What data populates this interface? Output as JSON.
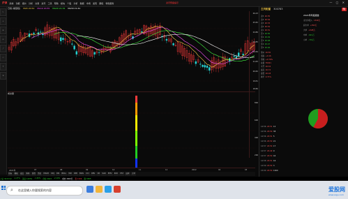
{
  "menu": [
    "系统",
    "功能",
    "报价",
    "分析",
    "交易",
    "资讯",
    "工具",
    "帮助",
    "模块",
    "个股",
    "分析",
    "数据",
    "市场",
    "发现",
    "期权",
    "特色服务"
  ],
  "app_logo": "沪深",
  "title_flag": "资讯预备提示",
  "window_controls": "— ▢ ✕",
  "chart": {
    "info": "日线 (前复权)",
    "ma_labels": [
      "MA5 20.52",
      "MA10 20.55",
      "MA20 21.34",
      "MA30 21.61"
    ],
    "price_axis": [
      "26.43",
      "25.82",
      "24.86",
      "23.85",
      "22.84",
      "21.83",
      "20.82",
      "19.81",
      "18.80"
    ],
    "sub_title": "成交量",
    "sub_axis": [
      "800",
      "600",
      "400",
      "200"
    ],
    "date_axis": [
      "2021年",
      "07",
      "08",
      "09",
      "10",
      "11",
      "12",
      "2022",
      "02",
      "03"
    ],
    "colors": {
      "up": "#ff3b3b",
      "down": "#27d2d2",
      "ma5": "#ffd24a",
      "ma10": "#ff55ff",
      "ma20": "#44ff44",
      "ma30": "#ffffff"
    }
  },
  "bottom_tabs": [
    "指标",
    "模板",
    "成交",
    "筹码",
    "游资",
    "资金",
    "MACD",
    "KDJ",
    "RSI",
    "BOLL",
    "WR",
    "DMI",
    "BIAS",
    "CCI",
    "OBV",
    "VR",
    "SAR",
    "EMV",
    "ROC",
    "PSY",
    "成本",
    "大单"
  ],
  "status": [
    {
      "t": "上证 3215.52",
      "c": "dn"
    },
    {
      "t": "-1.27%",
      "c": "dn"
    },
    {
      "t": "深证 12054",
      "c": "dn"
    },
    {
      "t": "-1.65%",
      "c": "dn"
    },
    {
      "t": "创业 2643",
      "c": "dn"
    },
    {
      "t": "-2.10%",
      "c": "dn"
    },
    {
      "t": "成交 4869亿",
      "c": "wt"
    },
    {
      "t": "涨 1324",
      "c": "up"
    },
    {
      "t": "跌 3385",
      "c": "dn"
    }
  ],
  "right_panel": {
    "name": "三只松鼠",
    "code": "300783",
    "badge": "融",
    "quote_rows": [
      {
        "k": "卖5",
        "v": "20.55"
      },
      {
        "k": "卖4",
        "v": "20.54"
      },
      {
        "k": "卖3",
        "v": "20.53"
      },
      {
        "k": "卖2",
        "v": "20.52"
      },
      {
        "k": "卖1",
        "v": "20.51"
      },
      {
        "k": "买1",
        "v": "20.50"
      },
      {
        "k": "买2",
        "v": "20.49"
      },
      {
        "k": "买3",
        "v": "20.48"
      },
      {
        "k": "买4",
        "v": "20.47"
      },
      {
        "k": "买5",
        "v": "20.46"
      },
      {
        "k": "现价",
        "v": "20.50"
      },
      {
        "k": "涨跌",
        "v": "+0.16"
      },
      {
        "k": "涨幅",
        "v": "+0.79%"
      },
      {
        "k": "总量",
        "v": "55021"
      },
      {
        "k": "今开",
        "v": "20.34"
      },
      {
        "k": "最高",
        "v": "20.72"
      },
      {
        "k": "最低",
        "v": "20.18"
      },
      {
        "k": "换手",
        "v": "2.71%"
      }
    ],
    "tick_rows": [
      {
        "t": "14:56",
        "p": "20.51",
        "v": "12"
      },
      {
        "t": "14:56",
        "p": "20.50",
        "v": "38"
      },
      {
        "t": "14:56",
        "p": "20.51",
        "v": "5"
      },
      {
        "t": "14:56",
        "p": "20.50",
        "v": "21"
      },
      {
        "t": "14:57",
        "p": "20.50",
        "v": "17"
      },
      {
        "t": "14:57",
        "p": "20.49",
        "v": "9"
      },
      {
        "t": "14:57",
        "p": "20.50",
        "v": "44"
      },
      {
        "t": "14:58",
        "p": "20.51",
        "v": "16"
      },
      {
        "t": "14:59",
        "p": "20.50",
        "v": "3"
      },
      {
        "t": "15:00",
        "p": "20.50",
        "v": "1260"
      }
    ],
    "side_title": "2021年年度报告",
    "side_rows": [
      {
        "k": "主力净流入",
        "v": "1340万"
      },
      {
        "k": "超大单",
        "v": "+812万"
      },
      {
        "k": "大单",
        "v": "+528万"
      },
      {
        "k": "中单",
        "v": "-621万"
      },
      {
        "k": "小单",
        "v": "-719万"
      }
    ],
    "pie_percent": 58
  },
  "taskbar": {
    "search_placeholder": "在这里输入你要搜索的内容",
    "watermark": "爱股网",
    "watermark_sub": "www.aigu.com"
  }
}
